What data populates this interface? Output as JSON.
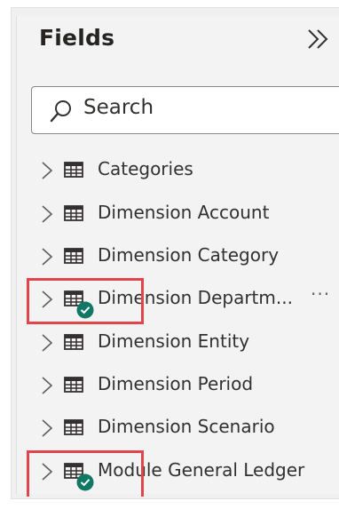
{
  "panel": {
    "title": "Fields",
    "collapse_icon": "double-chevron-right-icon"
  },
  "search": {
    "placeholder": "Search",
    "value": "",
    "icon": "search-icon"
  },
  "fields": [
    {
      "label": "Categories",
      "icon": "table-icon",
      "expand_icon": "chevron-right-icon"
    },
    {
      "label": "Dimension Account",
      "icon": "table-icon",
      "expand_icon": "chevron-right-icon"
    },
    {
      "label": "Dimension Category",
      "icon": "table-icon",
      "expand_icon": "chevron-right-icon"
    },
    {
      "label": "Dimension Departm...",
      "icon": "table-icon",
      "expand_icon": "chevron-right-icon",
      "status_icon": "check-circle-icon",
      "more": "···"
    },
    {
      "label": "Dimension Entity",
      "icon": "table-icon",
      "expand_icon": "chevron-right-icon"
    },
    {
      "label": "Dimension Period",
      "icon": "table-icon",
      "expand_icon": "chevron-right-icon"
    },
    {
      "label": "Dimension Scenario",
      "icon": "table-icon",
      "expand_icon": "chevron-right-icon"
    },
    {
      "label": "Module General Ledger",
      "icon": "table-icon",
      "expand_icon": "chevron-right-icon",
      "status_icon": "check-circle-icon"
    }
  ],
  "colors": {
    "highlight": "#e0454b",
    "check": "#117865",
    "text": "#323130"
  }
}
